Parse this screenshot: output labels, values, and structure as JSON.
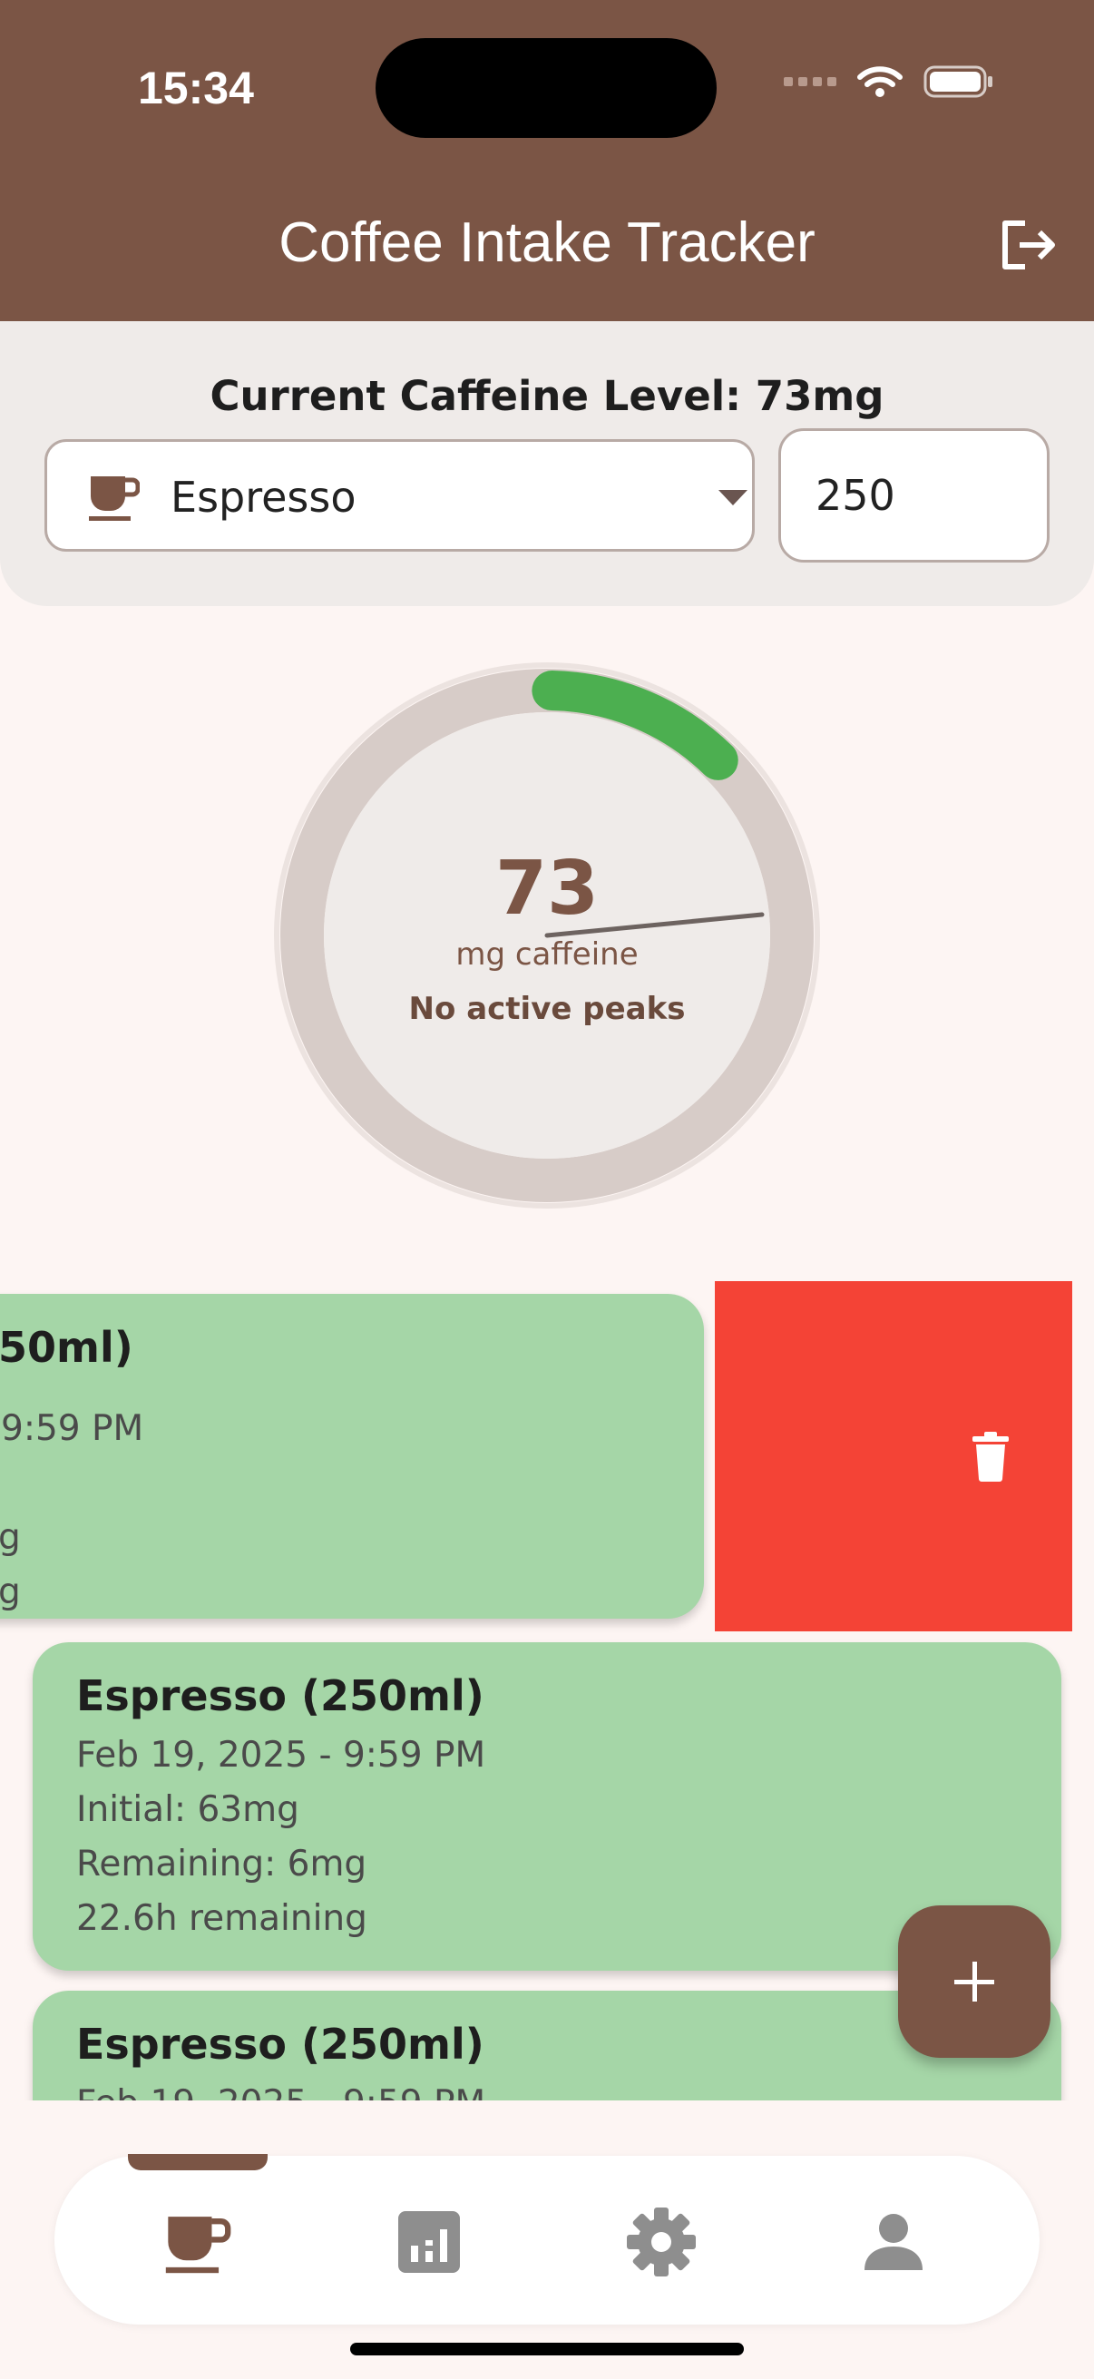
{
  "status_bar": {
    "time": "15:34"
  },
  "app_bar": {
    "title": "Coffee Intake Tracker"
  },
  "caffeine": {
    "current_level_text": "Current Caffeine Level: 73mg",
    "drink_selected": "Espresso",
    "amount_value": "250"
  },
  "gauge": {
    "value": "73",
    "unit": "mg caffeine",
    "peaks_text": "No active peaks",
    "fill_fraction": 0.12,
    "colors": {
      "track": "#d7ccc8",
      "fill": "#4caf50",
      "inner": "#efebe9",
      "needle": "#6d6360"
    }
  },
  "entries": [
    {
      "title": "Espresso (250ml)",
      "date": "Feb 19, 2025 - 9:59 PM",
      "initial": "Initial: 63mg",
      "remaining": "Remaining: 6mg",
      "time_left": "22.6h remaining",
      "visible_fragments": {
        "title": "50ml)",
        "date": "9:59 PM",
        "initial": "g",
        "remaining": "g"
      }
    },
    {
      "title": "Espresso (250ml)",
      "date": "Feb 19, 2025 - 9:59 PM",
      "initial": "Initial: 63mg",
      "remaining": "Remaining: 6mg",
      "time_left": "22.6h remaining"
    },
    {
      "title": "Espresso (250ml)",
      "date": "Feb 19, 2025 - 9:59 PM"
    }
  ],
  "actions": {
    "delete_icon": "trash-icon",
    "add_icon": "plus-icon"
  },
  "bottom_nav": {
    "items": [
      {
        "icon": "coffee-cup-icon",
        "active": true
      },
      {
        "icon": "chart-icon",
        "active": false
      },
      {
        "icon": "gear-icon",
        "active": false
      },
      {
        "icon": "person-icon",
        "active": false
      }
    ]
  },
  "colors": {
    "brand": "#7b5545",
    "card": "#a5d6a7",
    "delete": "#f44336",
    "background": "#fdf5f3",
    "panel": "#efebe9"
  }
}
